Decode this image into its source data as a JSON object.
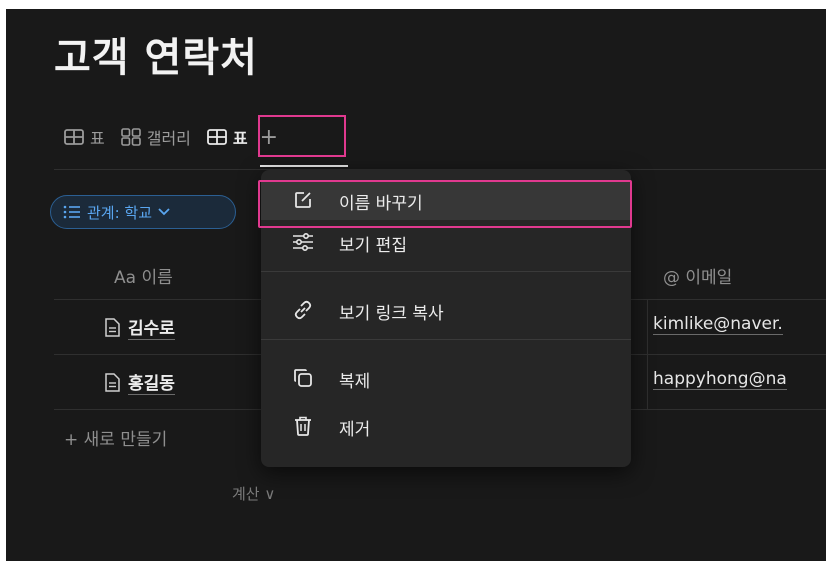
{
  "page": {
    "title": "고객 연락처"
  },
  "tabs": [
    {
      "icon": "table-icon",
      "label": "표"
    },
    {
      "icon": "gallery-icon",
      "label": "갤러리"
    },
    {
      "icon": "table-icon",
      "label": "표",
      "active": true
    }
  ],
  "add_view_label": "+",
  "filter": {
    "label": "관계: 학교",
    "icon": "list-icon",
    "chevron": "chevron-down-icon"
  },
  "columns": {
    "name": "Aa 이름",
    "email": "@ 이메일"
  },
  "rows": [
    {
      "name": "김수로",
      "email": "kimlike@naver."
    },
    {
      "name": "홍길동",
      "email": "happyhong@na"
    }
  ],
  "new_row_label": "+ 새로 만들기",
  "calc_label": "계산 ∨",
  "menu": {
    "items": [
      {
        "label": "이름 바꾸기",
        "icon": "edit-icon"
      },
      {
        "label": "보기 편집",
        "icon": "sliders-icon"
      },
      {
        "label": "보기 링크 복사",
        "icon": "link-icon"
      },
      {
        "label": "복제",
        "icon": "duplicate-icon"
      },
      {
        "label": "제거",
        "icon": "trash-icon"
      }
    ]
  },
  "colors": {
    "highlight": "#e0398f",
    "accent": "#5aa6f0"
  }
}
